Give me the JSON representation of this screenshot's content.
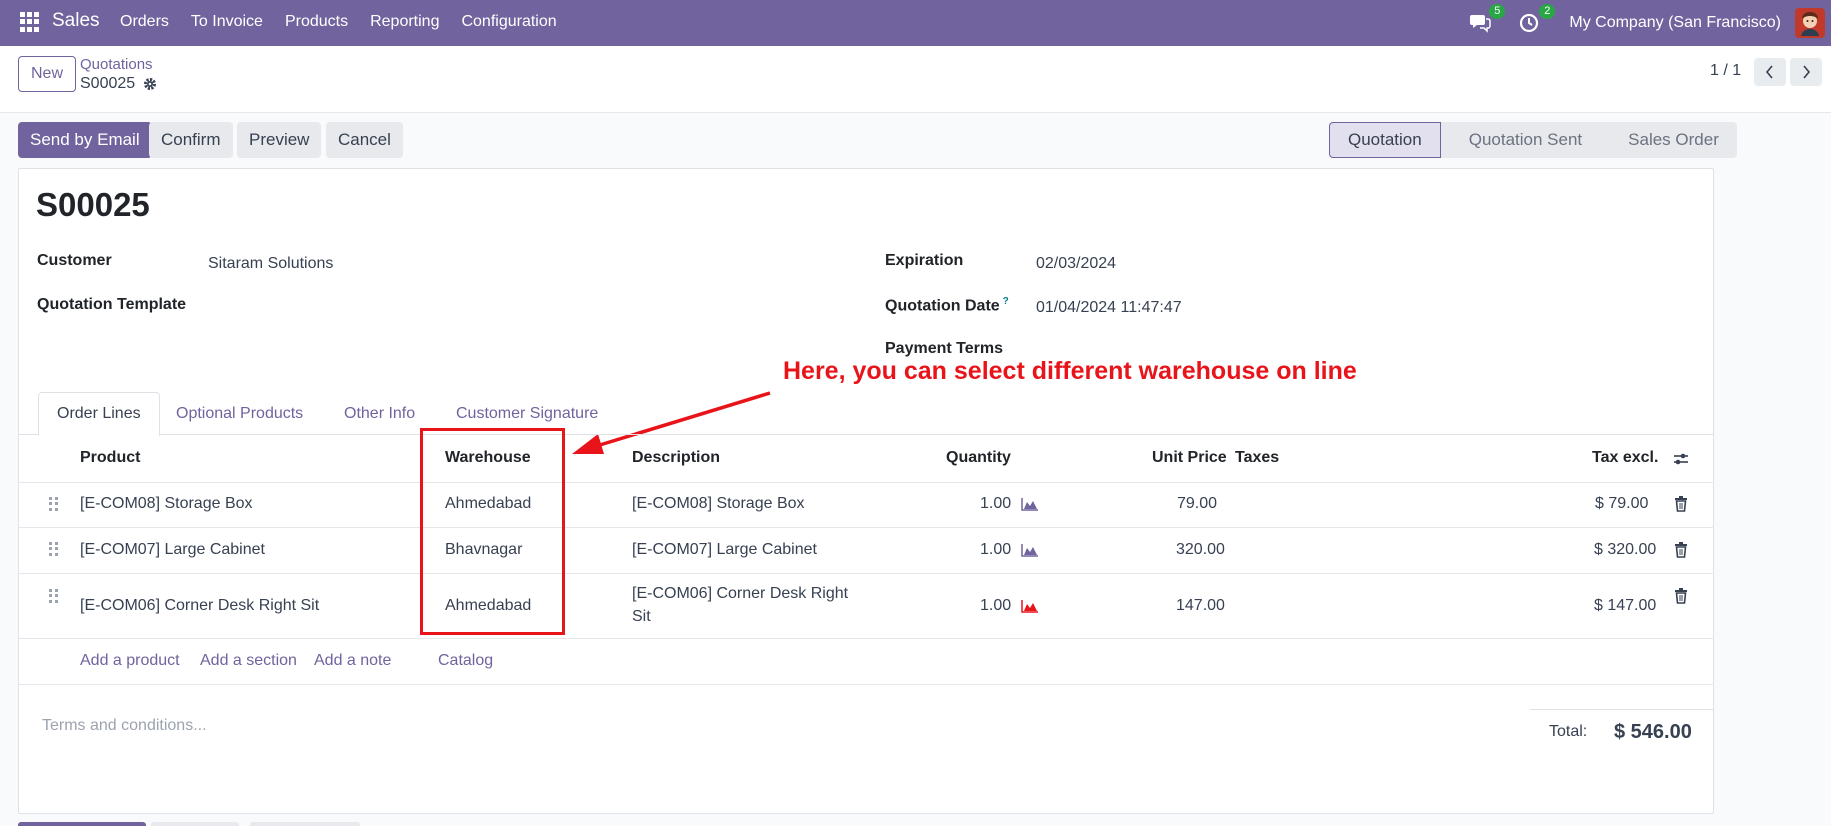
{
  "navbar": {
    "brand": "Sales",
    "menu": [
      "Orders",
      "To Invoice",
      "Products",
      "Reporting",
      "Configuration"
    ],
    "messages_count": "5",
    "activities_count": "2",
    "company": "My Company (San Francisco)"
  },
  "control": {
    "new_label": "New",
    "breadcrumb_parent": "Quotations",
    "breadcrumb_current": "S00025",
    "pager": "1 / 1"
  },
  "actions": {
    "send_email": "Send by Email",
    "confirm": "Confirm",
    "preview": "Preview",
    "cancel": "Cancel"
  },
  "status": {
    "stages": [
      "Quotation",
      "Quotation Sent",
      "Sales Order"
    ],
    "active": "Quotation"
  },
  "form": {
    "title": "S00025",
    "customer_label": "Customer",
    "customer_value": "Sitaram Solutions",
    "template_label": "Quotation Template",
    "expiration_label": "Expiration",
    "expiration_value": "02/03/2024",
    "quotation_date_label": "Quotation Date",
    "quotation_date_help": "?",
    "quotation_date_value": "01/04/2024 11:47:47",
    "payment_terms_label": "Payment Terms"
  },
  "annotation": {
    "text": "Here, you can select different warehouse on line",
    "color": "#e8141a"
  },
  "tabs": [
    "Order Lines",
    "Optional Products",
    "Other Info",
    "Customer Signature"
  ],
  "table": {
    "headers": {
      "product": "Product",
      "warehouse": "Warehouse",
      "description": "Description",
      "quantity": "Quantity",
      "unit_price": "Unit Price",
      "taxes": "Taxes",
      "tax_excl": "Tax excl."
    },
    "rows": [
      {
        "product": "[E-COM08] Storage Box",
        "warehouse": "Ahmedabad",
        "description": "[E-COM08] Storage Box",
        "description_2": "",
        "quantity": "1.00",
        "unit_price": "79.00",
        "subtotal": "$ 79.00",
        "forecast_color": "#71639e"
      },
      {
        "product": "[E-COM07] Large Cabinet",
        "warehouse": "Bhavnagar",
        "description": "[E-COM07] Large Cabinet",
        "description_2": "",
        "quantity": "1.00",
        "unit_price": "320.00",
        "subtotal": "$ 320.00",
        "forecast_color": "#71639e"
      },
      {
        "product": "[E-COM06] Corner Desk Right Sit",
        "warehouse": "Ahmedabad",
        "description": "[E-COM06] Corner Desk Right",
        "description_2": "Sit",
        "quantity": "1.00",
        "unit_price": "147.00",
        "subtotal": "$ 147.00",
        "forecast_color": "#e8141a"
      }
    ],
    "add_links": [
      "Add a product",
      "Add a section",
      "Add a note",
      "Catalog"
    ]
  },
  "footer": {
    "terms_placeholder": "Terms and conditions...",
    "total_label": "Total:",
    "total_value": "$ 546.00"
  }
}
